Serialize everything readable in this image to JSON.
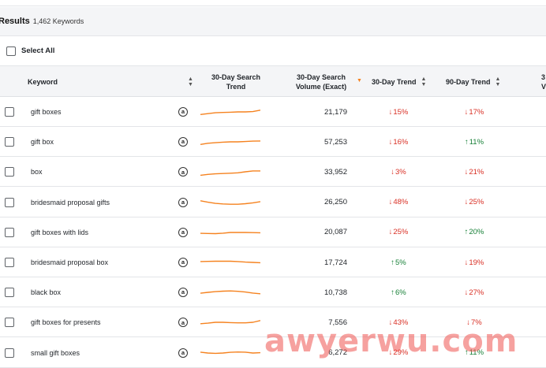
{
  "results": {
    "title": "Results",
    "count": "1,462 Keywords"
  },
  "select_all": {
    "label": "Select All"
  },
  "columns": {
    "keyword": "Keyword",
    "trend_line1": "30-Day Search",
    "trend_line2": "Trend",
    "volume_line1": "30-Day Search",
    "volume_line2": "Volume (Exact)",
    "trend30": "30-Day Trend",
    "trend90": "90-Day Trend",
    "cut_off_line1": "3",
    "cut_off_line2": "V"
  },
  "icons": {
    "sort": "sort-updown-icon",
    "sort_active": "sort-desc-icon",
    "amazon": "amazon-logo-icon",
    "arrow_up": "arrow-up-icon",
    "arrow_down": "arrow-down-icon"
  },
  "colors": {
    "up": "#188038",
    "down": "#d93025",
    "spark": "#f5821f",
    "accent": "#f5821f"
  },
  "rows": [
    {
      "keyword": "gift boxes",
      "volume": "21,179",
      "trend30": {
        "dir": "down",
        "arrow": "↓",
        "value": "15%"
      },
      "trend90": {
        "dir": "down",
        "arrow": "↓",
        "value": "17%"
      },
      "spark": [
        0.35,
        0.4,
        0.45,
        0.47,
        0.48,
        0.5,
        0.5,
        0.52,
        0.6
      ]
    },
    {
      "keyword": "gift box",
      "volume": "57,253",
      "trend30": {
        "dir": "down",
        "arrow": "↓",
        "value": "16%"
      },
      "trend90": {
        "dir": "up",
        "arrow": "↑",
        "value": "11%"
      },
      "spark": [
        0.35,
        0.42,
        0.45,
        0.48,
        0.5,
        0.5,
        0.52,
        0.54,
        0.55
      ]
    },
    {
      "keyword": "box",
      "volume": "33,952",
      "trend30": {
        "dir": "down",
        "arrow": "↓",
        "value": "3%"
      },
      "trend90": {
        "dir": "down",
        "arrow": "↓",
        "value": "21%"
      },
      "spark": [
        0.3,
        0.35,
        0.38,
        0.4,
        0.42,
        0.44,
        0.5,
        0.55,
        0.55
      ]
    },
    {
      "keyword": "bridesmaid proposal gifts",
      "volume": "26,250",
      "trend30": {
        "dir": "down",
        "arrow": "↓",
        "value": "48%"
      },
      "trend90": {
        "dir": "down",
        "arrow": "↓",
        "value": "25%"
      },
      "spark": [
        0.6,
        0.52,
        0.45,
        0.42,
        0.4,
        0.4,
        0.43,
        0.48,
        0.55
      ]
    },
    {
      "keyword": "gift boxes with lids",
      "volume": "20,087",
      "trend30": {
        "dir": "down",
        "arrow": "↓",
        "value": "25%"
      },
      "trend90": {
        "dir": "up",
        "arrow": "↑",
        "value": "20%"
      },
      "spark": [
        0.45,
        0.44,
        0.43,
        0.46,
        0.5,
        0.5,
        0.5,
        0.49,
        0.48
      ]
    },
    {
      "keyword": "bridesmaid proposal box",
      "volume": "17,724",
      "trend30": {
        "dir": "up",
        "arrow": "↑",
        "value": "5%"
      },
      "trend90": {
        "dir": "down",
        "arrow": "↓",
        "value": "19%"
      },
      "spark": [
        0.55,
        0.56,
        0.57,
        0.57,
        0.57,
        0.55,
        0.52,
        0.5,
        0.48
      ]
    },
    {
      "keyword": "black box",
      "volume": "10,738",
      "trend30": {
        "dir": "up",
        "arrow": "↑",
        "value": "6%"
      },
      "trend90": {
        "dir": "down",
        "arrow": "↓",
        "value": "27%"
      },
      "spark": [
        0.45,
        0.5,
        0.54,
        0.57,
        0.58,
        0.56,
        0.52,
        0.46,
        0.42
      ]
    },
    {
      "keyword": "gift boxes for presents",
      "volume": "7,556",
      "trend30": {
        "dir": "down",
        "arrow": "↓",
        "value": "43%"
      },
      "trend90": {
        "dir": "down",
        "arrow": "↓",
        "value": "7%"
      },
      "spark": [
        0.42,
        0.45,
        0.5,
        0.5,
        0.48,
        0.47,
        0.47,
        0.5,
        0.6
      ]
    },
    {
      "keyword": "small gift boxes",
      "volume": "6,272",
      "trend30": {
        "dir": "down",
        "arrow": "↓",
        "value": "29%"
      },
      "trend90": {
        "dir": "up",
        "arrow": "↑",
        "value": "11%"
      },
      "spark": [
        0.55,
        0.5,
        0.48,
        0.5,
        0.54,
        0.56,
        0.55,
        0.5,
        0.52
      ]
    }
  ],
  "watermark": "awyerwu.com"
}
